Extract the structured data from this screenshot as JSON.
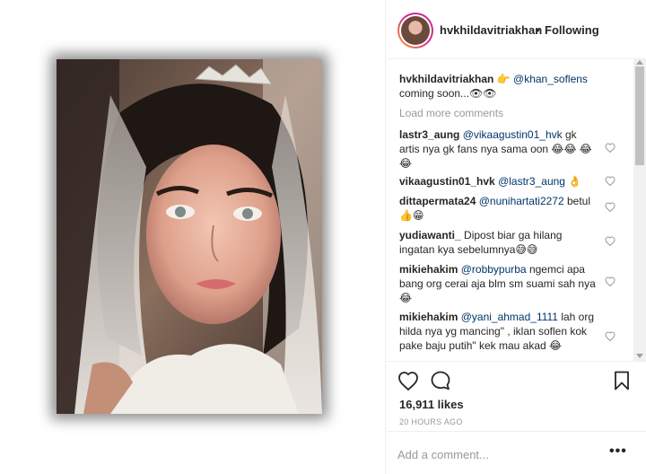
{
  "post": {
    "username": "hvkhildavitriakhan",
    "separator": "•",
    "follow_status": "Following",
    "media_alt": "photo"
  },
  "caption": {
    "username": "hvkhildavitriakhan",
    "emoji_pointing": "👉",
    "mention": "@khan_soflens",
    "text": "coming soon...👁👁"
  },
  "load_more": "Load more comments",
  "comments": [
    {
      "username": "lastr3_aung",
      "mention": "@vikaagustin01_hvk",
      "text": " gk artis nya gk fans nya sama oon 😂😂 😂😂"
    },
    {
      "username": "vikaagustin01_hvk",
      "mention": "@lastr3_aung",
      "text": " 👌"
    },
    {
      "username": "dittapermata24",
      "mention": "@nunihartati2272",
      "text": " betul 👍😁"
    },
    {
      "username": "yudiawanti_",
      "mention": "",
      "text": " Dipost biar ga hilang ingatan kya sebelumnya😅😅"
    },
    {
      "username": "mikiehakim",
      "mention": "@robbypurba",
      "text": " ngemci apa bang org cerai aja blm sm suami sah nya 😂"
    },
    {
      "username": "mikiehakim",
      "mention": "@yani_ahmad_1111",
      "text": " lah org hilda nya yg mancing\" , iklan soflen kok pake baju putih\" kek mau akad 😂"
    }
  ],
  "actions": {
    "likes": "16,911 likes",
    "time_ago": "20 HOURS AGO",
    "like_icon": "heart-icon",
    "comment_icon": "comment-bubble-icon",
    "save_icon": "bookmark-icon"
  },
  "add_comment": {
    "placeholder": "Add a comment...",
    "more": "•••"
  },
  "colors": {
    "text": "#262626",
    "mention": "#003569",
    "muted": "#999999",
    "border": "#efefef",
    "story_ring_start": "#f5a623",
    "story_ring_end": "#c13584"
  }
}
